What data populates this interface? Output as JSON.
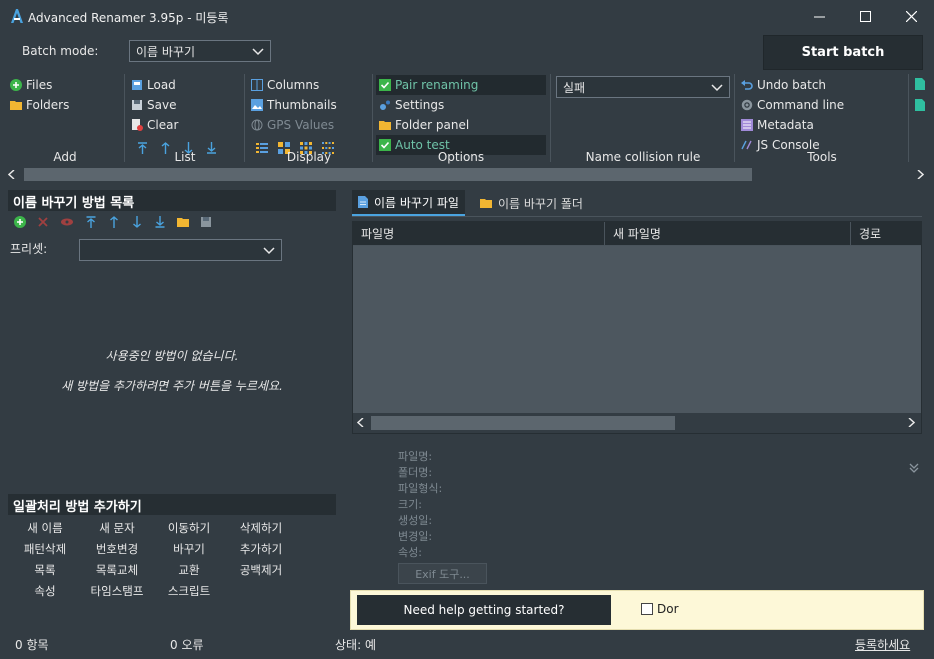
{
  "window": {
    "title": "Advanced Renamer 3.95p - 미등록"
  },
  "header": {
    "batch_mode_label": "Batch mode:",
    "batch_mode_value": "이름 바꾸기",
    "start_batch_label": "Start batch"
  },
  "toolbar": {
    "add": {
      "group_label": "Add",
      "files": "Files",
      "folders": "Folders"
    },
    "list": {
      "group_label": "List",
      "load": "Load",
      "save": "Save",
      "clear": "Clear"
    },
    "display": {
      "group_label": "Display",
      "columns": "Columns",
      "thumbnails": "Thumbnails",
      "gps_values": "GPS Values"
    },
    "options": {
      "group_label": "Options",
      "pair_renaming": "Pair renaming",
      "settings": "Settings",
      "folder_panel": "Folder panel",
      "auto_test": "Auto test"
    },
    "collision": {
      "group_label": "Name collision rule",
      "value": "실패"
    },
    "tools": {
      "group_label": "Tools",
      "undo_batch": "Undo batch",
      "command_line": "Command line",
      "metadata": "Metadata",
      "js_console": "JS Console"
    }
  },
  "methods_panel": {
    "title": "이름 바꾸기 방법 목록",
    "preset_label": "프리셋:",
    "preset_value": "",
    "empty_line1": "사용중인 방법이 없습니다.",
    "empty_line2": "새 방법을 추가하려면 주가 버튼을 누르세요."
  },
  "add_methods": {
    "title": "일괄처리 방법 추가하기",
    "items": [
      "새 이름",
      "새 문자",
      "이동하기",
      "삭제하기",
      "패턴삭제",
      "번호변경",
      "바꾸기",
      "추가하기",
      "목록",
      "목록교체",
      "교환",
      "공백제거",
      "속성",
      "타임스탬프",
      "스크립트"
    ]
  },
  "files_panel": {
    "tabs": [
      "이름 바꾸기 파일",
      "이름 바꾸기 폴더"
    ],
    "columns": [
      "파일명",
      "새 파일명",
      "경로"
    ]
  },
  "info_panel": {
    "fields": [
      "파일명:",
      "폴더명:",
      "파일형식:",
      "크기:",
      "생성일:",
      "변경일:",
      "속성:"
    ],
    "exif_button": "Exif 도구..."
  },
  "help_bar": {
    "button": "Need help getting started?",
    "checkbox_label": "Dor"
  },
  "status_bar": {
    "items_count": "0 항목",
    "errors_count": "0 오류",
    "state": "상태: 예",
    "register_link": "등록하세요"
  },
  "colors": {
    "background": "#333c43",
    "dark": "#262e33",
    "accent": "#4aa3df",
    "help_bg": "#fdf8d8"
  }
}
